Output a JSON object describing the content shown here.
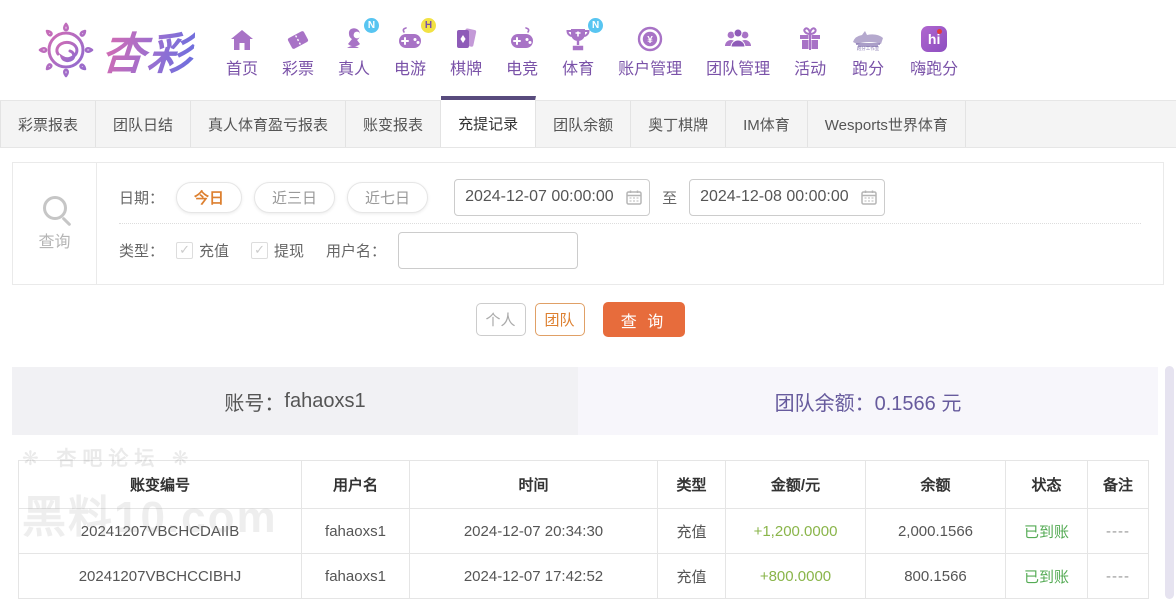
{
  "brand": {
    "name": "杏彩"
  },
  "nav": {
    "items": [
      {
        "label": "首页"
      },
      {
        "label": "彩票"
      },
      {
        "label": "真人",
        "badge": "N"
      },
      {
        "label": "电游",
        "badge": "H"
      },
      {
        "label": "棋牌"
      },
      {
        "label": "电竞"
      },
      {
        "label": "体育",
        "badge": "N"
      },
      {
        "label": "账户管理"
      },
      {
        "label": "团队管理"
      },
      {
        "label": "活动"
      },
      {
        "label": "跑分"
      },
      {
        "label": "嗨跑分"
      }
    ],
    "hi_app_text": "hi"
  },
  "tabs": {
    "items": [
      "彩票报表",
      "团队日结",
      "真人体育盈亏报表",
      "账变报表",
      "充提记录",
      "团队余额",
      "奥丁棋牌",
      "IM体育",
      "Wesports世界体育"
    ],
    "active": "充提记录"
  },
  "filter": {
    "date_label": "日期：",
    "quick": [
      "今日",
      "近三日",
      "近七日"
    ],
    "quick_active": "今日",
    "date_from": "2024-12-07 00:00:00",
    "to_label": "至",
    "date_to": "2024-12-08 00:00:00",
    "type_label": "类型：",
    "types": [
      "充值",
      "提现"
    ],
    "username_label": "用户名：",
    "username_value": "",
    "search_label": "查询"
  },
  "actions": {
    "personal": "个人",
    "team": "团队",
    "query": "查 询"
  },
  "account": {
    "label": "账号：",
    "value": "fahaoxs1",
    "balance_label": "团队余额：",
    "balance_value": "0.1566 元"
  },
  "table": {
    "headers": [
      "账变编号",
      "用户名",
      "时间",
      "类型",
      "金额/元",
      "余额",
      "状态",
      "备注"
    ],
    "rows": [
      [
        "20241207VBCHCDAIIB",
        "fahaoxs1",
        "2024-12-07 20:34:30",
        "充值",
        "+1,200.0000",
        "2,000.1566",
        "已到账",
        "----"
      ],
      [
        "20241207VBCHCCIBHJ",
        "fahaoxs1",
        "2024-12-07 17:42:52",
        "充值",
        "+800.0000",
        "800.1566",
        "已到账",
        "----"
      ]
    ]
  },
  "watermark": {
    "line1": "❋ 杏吧论坛 ❋",
    "line2": "黑料10.com"
  },
  "colors": {
    "accent_purple": "#7a52a8",
    "tab_marker_purple": "#584b7d",
    "button_orange": "#e76c3c",
    "text_orange": "#dd8030",
    "amount_green": "#8ab54a",
    "status_green": "#55ab55",
    "balance_purple": "#675b9d",
    "badge_blue": "#58c5f1",
    "badge_yellow": "#f2e244"
  }
}
